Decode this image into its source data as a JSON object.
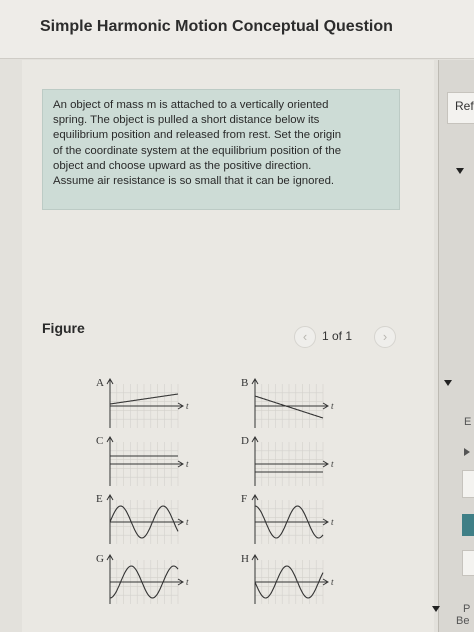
{
  "header": {
    "title": "Simple Harmonic Motion Conceptual Question"
  },
  "problem": {
    "lines": [
      "An object of mass m is attached to a vertically oriented",
      "spring. The object is pulled a short distance below its",
      "equilibrium position and released from rest. Set the origin",
      "of the coordinate system at the equilibrium position of the",
      "object and choose upward as the positive direction.",
      "Assume air resistance is so small that it can be ignored."
    ]
  },
  "figure": {
    "label": "Figure",
    "pager": {
      "text": "1 of 1",
      "prev_icon": "chevron-left-icon",
      "next_icon": "chevron-right-icon"
    },
    "graphs": [
      {
        "id": "A",
        "curve": "rising-line"
      },
      {
        "id": "B",
        "curve": "falling-line"
      },
      {
        "id": "C",
        "curve": "flat-above"
      },
      {
        "id": "D",
        "curve": "flat-below"
      },
      {
        "id": "E",
        "curve": "sine-from-zero-up"
      },
      {
        "id": "F",
        "curve": "sine-from-top"
      },
      {
        "id": "G",
        "curve": "sine-from-bottom"
      },
      {
        "id": "H",
        "curve": "sine-from-zero-down"
      }
    ],
    "axis_label": "t"
  },
  "right_panel": {
    "ref_tab": "Ref",
    "letters": [
      "E",
      "P"
    ],
    "bottom": "Be"
  },
  "colors": {
    "problem_bg": "#cddcd6",
    "teal": "#3f7f86"
  }
}
